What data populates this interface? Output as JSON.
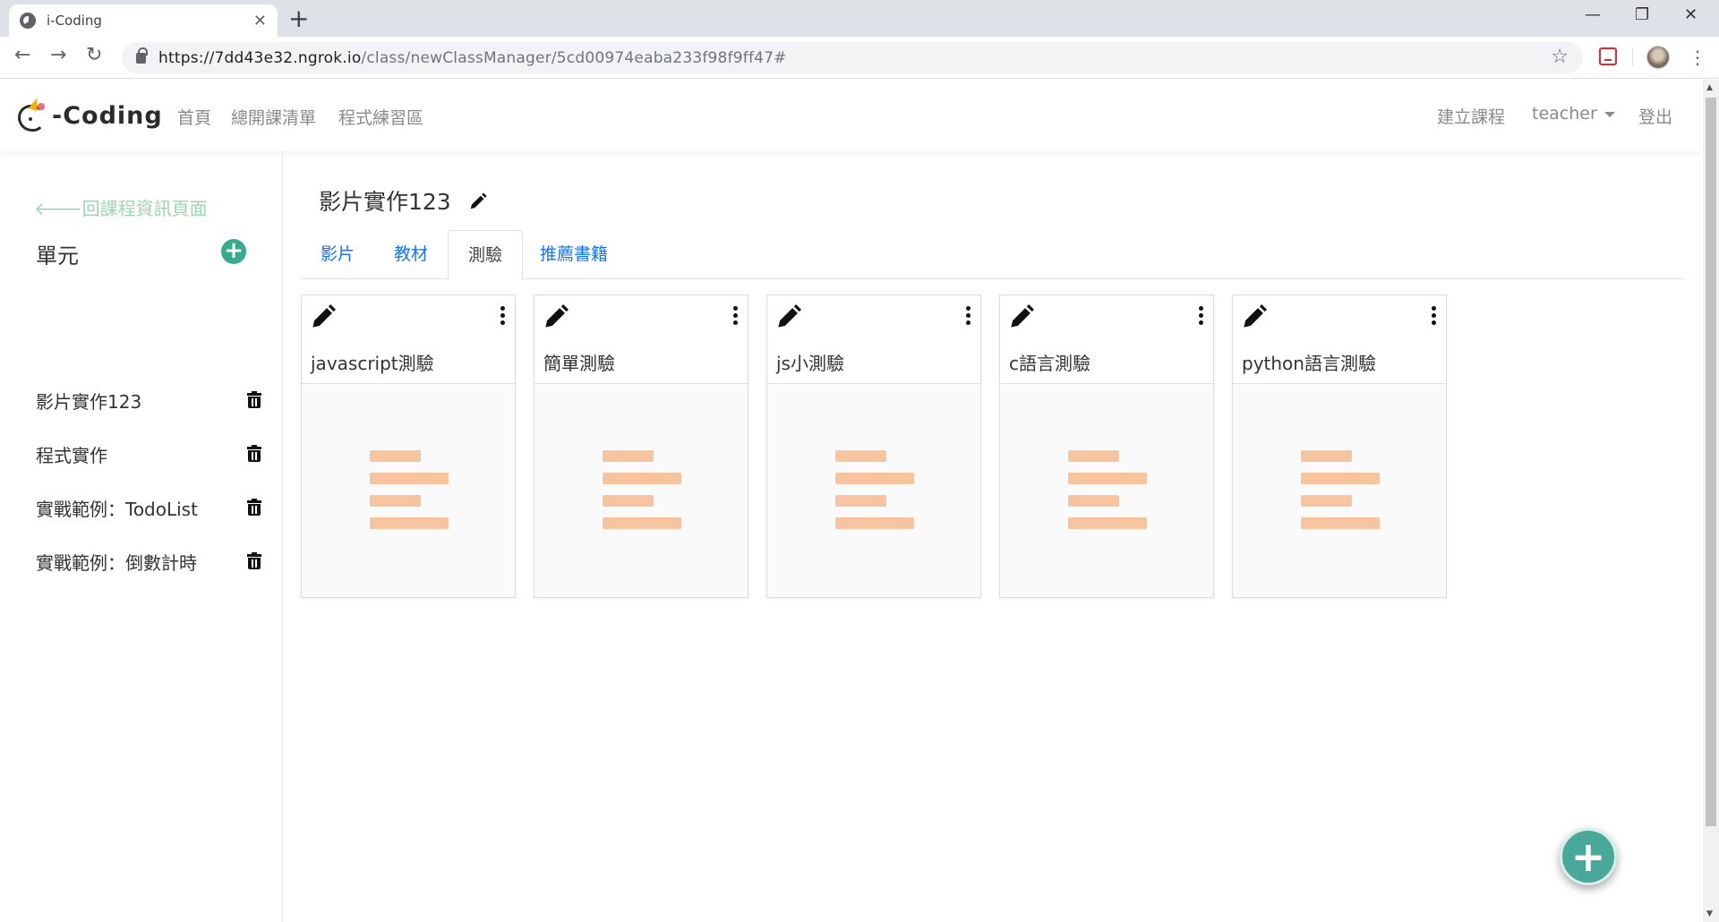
{
  "browser": {
    "tab_title": "i-Coding",
    "url_host": "https://7dd43e32.ngrok.io",
    "url_path": "/class/newClassManager/5cd00974eaba233f98f9ff47#"
  },
  "site_nav": {
    "logo_text": "-Coding",
    "links": [
      "首頁",
      "總開課清單",
      "程式練習區"
    ],
    "create_course": "建立課程",
    "user": "teacher",
    "logout": "登出"
  },
  "sidebar": {
    "back_link": "回課程資訊頁面",
    "units_title": "單元",
    "units": [
      {
        "label": "影片實作123"
      },
      {
        "label": "程式實作"
      },
      {
        "label": "實戰範例：TodoList"
      },
      {
        "label": "實戰範例：倒數計時"
      }
    ]
  },
  "main": {
    "unit_title": "影片實作123",
    "tabs": [
      {
        "label": "影片",
        "active": false
      },
      {
        "label": "教材",
        "active": false
      },
      {
        "label": "測驗",
        "active": true
      },
      {
        "label": "推薦書籍",
        "active": false
      }
    ],
    "quizzes": [
      {
        "title": "javascript測驗"
      },
      {
        "title": "簡單測驗"
      },
      {
        "title": "js小測驗"
      },
      {
        "title": "c語言測驗"
      },
      {
        "title": "python語言測驗"
      }
    ]
  },
  "colors": {
    "accent": "#3aaa8f",
    "link": "#1a73e8",
    "placeholder_bars": "#f6c59f",
    "back_link": "#9fd4b2"
  }
}
